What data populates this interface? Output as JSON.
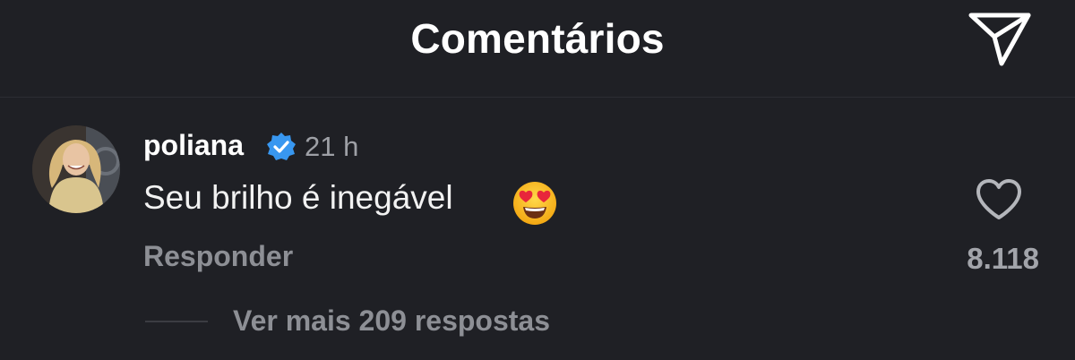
{
  "header": {
    "title": "Comentários",
    "share_icon": "send-icon"
  },
  "comment": {
    "username": "poliana",
    "verified": true,
    "verified_color": "#3897f0",
    "time": "21 h",
    "text": "Seu brilho é inegável",
    "emoji": "smiling-face-with-heart-eyes",
    "reply_label": "Responder",
    "like_icon": "heart-icon",
    "like_count": "8.118",
    "view_replies_label": "Ver mais 209 respostas"
  }
}
